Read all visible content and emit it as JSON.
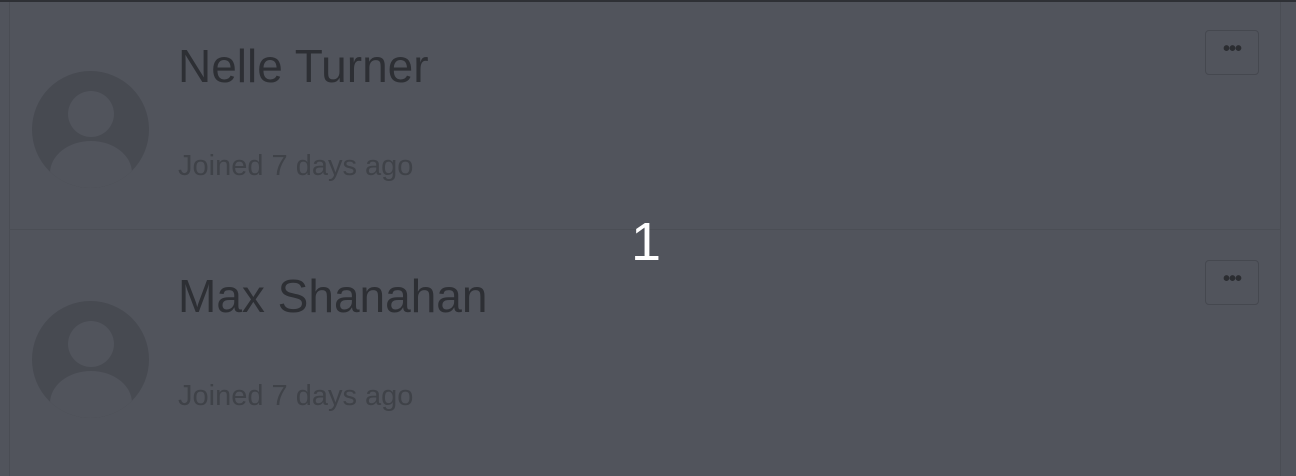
{
  "members": [
    {
      "name": "Nelle Turner",
      "joined": "Joined 7 days ago",
      "more_label": "•••"
    },
    {
      "name": "Max Shanahan",
      "joined": "Joined 7 days ago",
      "more_label": "•••"
    }
  ],
  "overlay": {
    "step_number": "1"
  },
  "icons": {
    "avatar": "user-placeholder-icon",
    "more": "ellipsis-icon"
  }
}
